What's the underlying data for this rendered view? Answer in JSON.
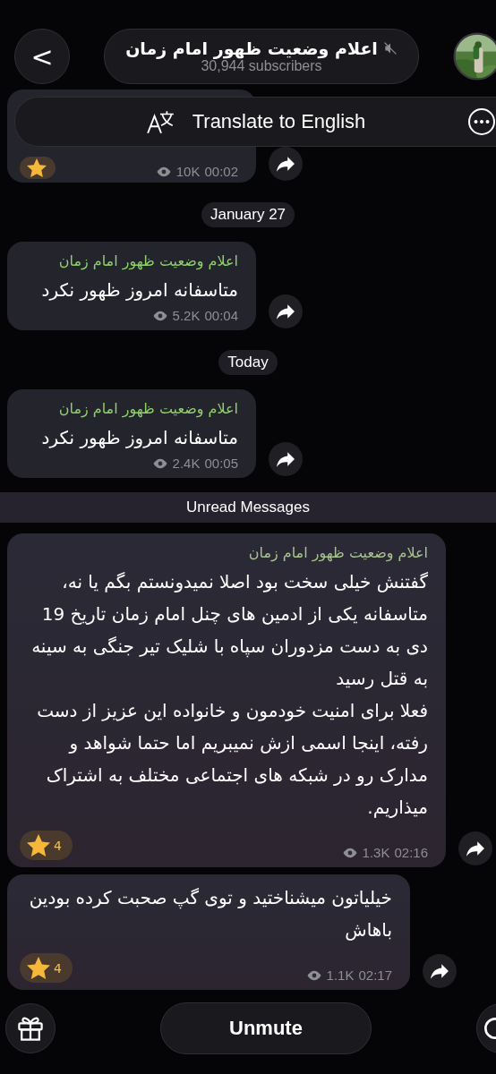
{
  "header": {
    "back": "<",
    "title": "اعلام وضعیت ظهور امام زمان",
    "muted": true,
    "subtitle": "30,944 subscribers"
  },
  "translate_bar": {
    "label": "Translate to English"
  },
  "feed": [
    {
      "kind": "partial_message",
      "views": "10K",
      "time": "00:02",
      "starred": true
    },
    {
      "kind": "date",
      "label": "January 27"
    },
    {
      "kind": "message",
      "sender": "اعلام وضعیت ظهور امام زمان",
      "text": "متاسفانه امروز ظهور نکرد",
      "views": "5.2K",
      "time": "00:04",
      "starred": false
    },
    {
      "kind": "date",
      "label": "Today"
    },
    {
      "kind": "message",
      "sender": "اعلام وضعیت ظهور امام زمان",
      "text": "متاسفانه امروز ظهور نکرد",
      "views": "2.4K",
      "time": "00:05",
      "starred": false
    },
    {
      "kind": "unread",
      "label": "Unread Messages"
    },
    {
      "kind": "long_message",
      "sender": "اعلام وضعیت ظهور امام زمان",
      "text": "گفتنش خیلی سخت بود اصلا نمیدونستم بگم یا نه،\nمتاسفانه یکی از ادمین های چنل امام زمان تاریخ 19 دی به دست مزدوران سپاه با شلیک تیر جنگی به سینه به قتل رسید\nفعلا برای امنیت خودمون و خانواده این عزیز از دست رفته، اینجا اسمی ازش نمیبریم اما حتما شواهد و مدارک رو در شبکه های اجتماعی مختلف به اشتراک میذاریم.",
      "views": "1.3K",
      "time": "02:16",
      "starred": true,
      "reaction_count": "4"
    },
    {
      "kind": "long_message",
      "text": "خیلیاتون میشناختید و توی گپ صحبت کرده بودین باهاش",
      "views": "1.1K",
      "time": "02:17",
      "starred": true,
      "reaction_count": "4"
    }
  ],
  "bottom_bar": {
    "button": "Unmute"
  }
}
